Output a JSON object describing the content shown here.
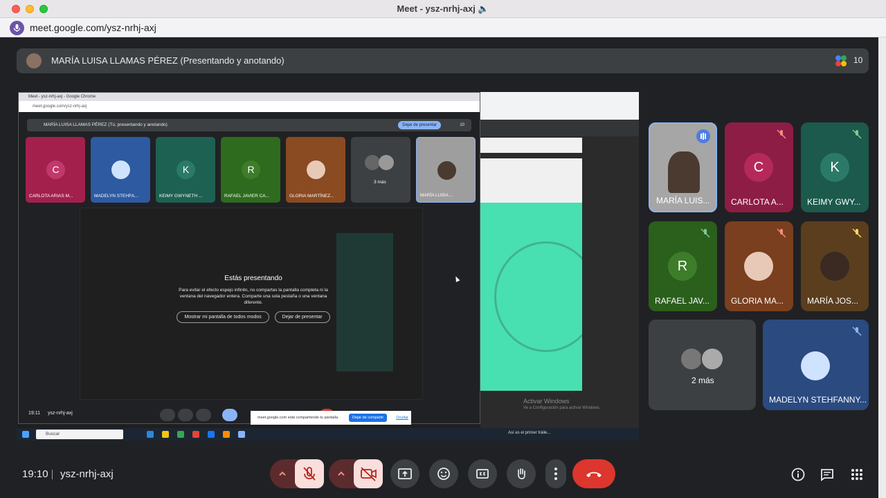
{
  "window": {
    "title": "Meet - ysz-nrhj-axj 🔈"
  },
  "browser": {
    "url": "meet.google.com/ysz-nrhj-axj"
  },
  "presenter": {
    "label": "MARÍA LUISA LLAMAS PÉREZ (Presentando y anotando)"
  },
  "people_count": "10",
  "shared_screen": {
    "window_title": "Meet - ysz-nrhj-axj - Google Chrome",
    "url": "meet.google.com/ysz-nrhj-axj",
    "presenter_label": "MARÍA LUISA LLAMAS PÉREZ (Tú, presentando y anotando)",
    "stop_button": "Dejar de presentar",
    "count": "10",
    "tiles": [
      {
        "initial": "C",
        "name": "CARLOTA ARIAS M...",
        "color": "#a3204c"
      },
      {
        "initial": "",
        "name": "MADELYN STEHFA...",
        "color": "#2d5aa1"
      },
      {
        "initial": "K",
        "name": "KEIMY GWYNETH ...",
        "color": "#1d6152"
      },
      {
        "initial": "R",
        "name": "RAFAEL JAVIER CA...",
        "color": "#2e6b1e"
      },
      {
        "initial": "",
        "name": "GLORIA MARTÍNEZ...",
        "color": "#8a4a22"
      },
      {
        "initial": "",
        "name": "3 más",
        "color": "#3c4043"
      },
      {
        "initial": "",
        "name": "MARÍA LUISA ...",
        "color": "#9e9e9e"
      }
    ],
    "dialog": {
      "title": "Estás presentando",
      "body": "Para evitar el efecto espejo infinito, no compartas la pantalla completa ni la ventana del navegador entera. Comparte una sola pestaña o una ventana diferente.",
      "btn_show": "Mostrar mi pantalla de todos modos",
      "btn_stop": "Dejar de presentar"
    },
    "bottom_time": "19:11",
    "bottom_code": "ysz-nrhj-axj",
    "share_banner": "meet.google.com está compartiendo tu pantalla.",
    "share_stop": "Dejar de compartir",
    "share_hide": "Ocultar",
    "activate_title": "Activar Windows",
    "activate_sub": "Ve a Configuración para activar Windows.",
    "taskbar_search": "Buscar",
    "taskbar_right": "Así es el primer tráile..."
  },
  "participants": [
    {
      "name": "MARÍA LUIS...",
      "initial": "",
      "color": "#a6a6a6",
      "speaking": true
    },
    {
      "name": "CARLOTA A...",
      "initial": "C",
      "color": "#8d1d44",
      "avatar_color": "#b5295a"
    },
    {
      "name": "KEIMY GWY...",
      "initial": "K",
      "color": "#1b5a4c",
      "avatar_color": "#2b7a67"
    },
    {
      "name": "RAFAEL JAV...",
      "initial": "R",
      "color": "#2b5f1c",
      "avatar_color": "#3d7d2a"
    },
    {
      "name": "GLORIA MA...",
      "initial": "",
      "color": "#7a3f1e",
      "avatar_color": "#e8c9b7"
    },
    {
      "name": "MARÍA JOS...",
      "initial": "",
      "color": "#5a3e1e",
      "avatar_color": "#3a2a22"
    },
    {
      "name": "2 más",
      "initial": "",
      "color": "#3c4043"
    },
    {
      "name": "MADELYN STEHFANNY...",
      "initial": "",
      "color": "#2a4a80",
      "avatar_color": "#cfe3ff"
    }
  ],
  "bottom": {
    "time": "19:10",
    "meeting_code": "ysz-nrhj-axj"
  },
  "colors": {
    "background": "#202124",
    "panel": "#3c4043",
    "muted_group": "#5c2b2e",
    "end_call": "#dc362e"
  }
}
